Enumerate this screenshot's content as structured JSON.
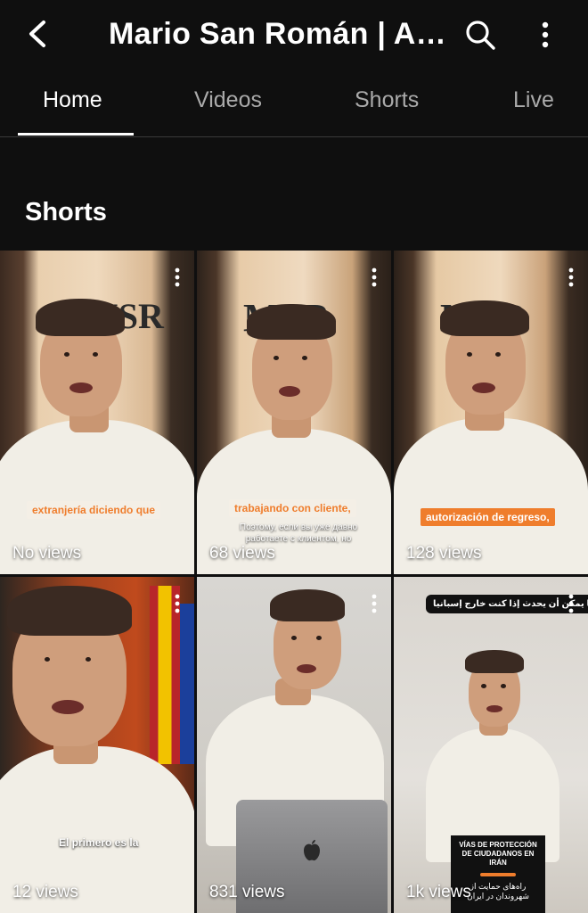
{
  "header": {
    "title": "Mario San Román | Ab...",
    "back_icon": "arrow-left-icon",
    "search_icon": "search-icon",
    "more_icon": "more-vertical-icon"
  },
  "tabs": [
    {
      "label": "Home",
      "active": true
    },
    {
      "label": "Videos",
      "active": false
    },
    {
      "label": "Shorts",
      "active": false
    },
    {
      "label": "Live",
      "active": false
    }
  ],
  "section": {
    "title": "Shorts"
  },
  "shorts": [
    {
      "views": "No views",
      "caption": "extranjería diciendo que",
      "caption_style": "white"
    },
    {
      "views": "68 views",
      "caption": "trabajando con cliente,",
      "subcaption": "Поэтому, если вы уже давно работаете с клиентом, но",
      "caption_style": "white"
    },
    {
      "views": "128 views",
      "caption": "autorización de regreso,",
      "caption_style": "orange"
    },
    {
      "views": "12 views",
      "caption": "El primero es la",
      "caption_style": "plain"
    },
    {
      "views": "831 views",
      "caption": "",
      "caption_style": "none"
    },
    {
      "views": "1k views",
      "caption": "ﺻﺢ ﻣﺎ ﻳﻤﻜﻦ ﺃﻥ ﻳﺤﺪﺙ ﺇﺫﺍ ﻛﻨﺖ ﺧﺎﺭﺝ ﺇﺳﺒﺎﻧﻴﺎ",
      "card_title": "VÍAS DE PROTECCIÓN DE CIUDADANOS EN IRÁN",
      "card_subtitle": "راه‌های حمایت از شهروندان در ایران",
      "caption_style": "dark"
    }
  ],
  "colors": {
    "background": "#0f0f0f",
    "accent_orange": "#ef7d2c",
    "tab_inactive": "#aaaaaa"
  }
}
